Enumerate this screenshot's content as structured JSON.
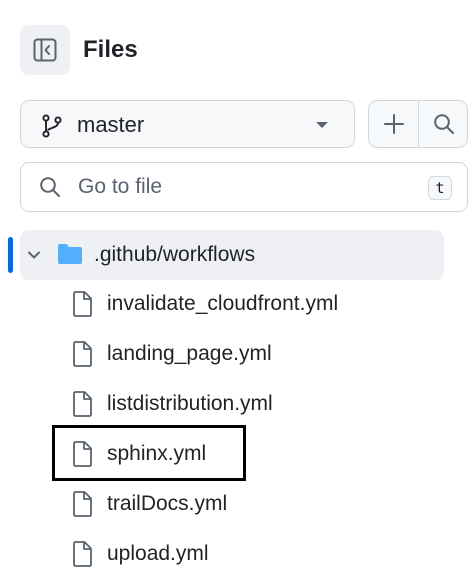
{
  "header": {
    "title": "Files",
    "toggle_icon": "sidebar-collapse-icon"
  },
  "branch": {
    "name": "master",
    "icon": "git-branch-icon"
  },
  "actions": {
    "add_icon": "plus-icon",
    "search_icon": "search-icon"
  },
  "search": {
    "placeholder": "Go to file",
    "shortcut": "t"
  },
  "tree": {
    "folder": {
      "name": ".github/workflows",
      "expanded": true,
      "color": "#54aeff"
    },
    "files": [
      {
        "name": "invalidate_cloudfront.yml"
      },
      {
        "name": "landing_page.yml"
      },
      {
        "name": "listdistribution.yml"
      },
      {
        "name": "sphinx.yml",
        "highlighted": true
      },
      {
        "name": "trailDocs.yml"
      },
      {
        "name": "upload.yml"
      }
    ]
  },
  "colors": {
    "accent": "#0969da",
    "highlight_border": "#000000"
  }
}
